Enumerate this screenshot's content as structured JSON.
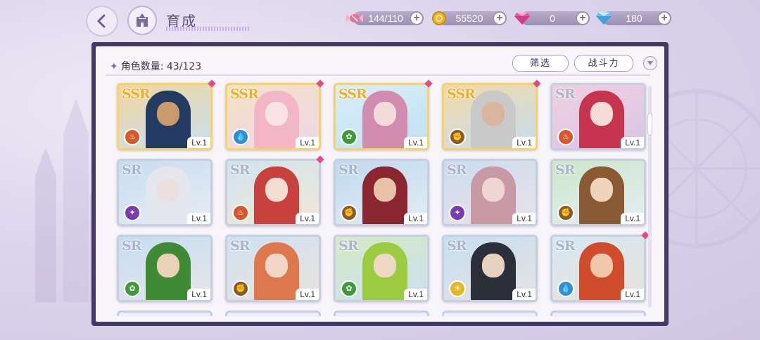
{
  "header": {
    "title": "育成",
    "back_icon": "back-arrow-icon",
    "home_icon": "castle-home-icon"
  },
  "currencies": [
    {
      "icon": "candy-stamina-icon",
      "value": "144/110"
    },
    {
      "icon": "gold-coin-icon",
      "value": "55520"
    },
    {
      "icon": "pink-gem-icon",
      "value": "0"
    },
    {
      "icon": "blue-diamond-icon",
      "value": "180"
    }
  ],
  "panel": {
    "count_label": "角色数量: 43/123",
    "filter_label": "筛选",
    "sort_label": "战斗力"
  },
  "cards": [
    {
      "rarity": "SSR",
      "level": "Lv.1",
      "attr": "fire",
      "new": true,
      "hair": "#233a63",
      "tone": "#c99a6a",
      "bg": [
        "#f3d6a0",
        "#c9e0f0"
      ]
    },
    {
      "rarity": "SSR",
      "level": "Lv.1",
      "attr": "water",
      "new": true,
      "hair": "#f2b6c8",
      "tone": "#f7e3e6",
      "bg": [
        "#f4e2c4",
        "#eed6e8"
      ]
    },
    {
      "rarity": "SSR",
      "level": "Lv.1",
      "attr": "grass",
      "new": true,
      "hair": "#d28cb0",
      "tone": "#f2dbd9",
      "bg": [
        "#d9eef8",
        "#bfe1f2"
      ]
    },
    {
      "rarity": "SSR",
      "level": "Lv.1",
      "attr": "earth",
      "new": true,
      "hair": "#c9c9c9",
      "tone": "#d8b59c",
      "bg": [
        "#f2d9a8",
        "#c7dff0"
      ]
    },
    {
      "rarity": "SR",
      "level": "Lv.1",
      "attr": "fire",
      "new": false,
      "hair": "#c7344f",
      "tone": "#f5dcd6",
      "bg": [
        "#f1cfe0",
        "#d8c6e6"
      ]
    },
    {
      "rarity": "SR",
      "level": "Lv.1",
      "attr": "dark",
      "new": false,
      "hair": "#e6e6ee",
      "tone": "#ecdfe0",
      "bg": [
        "#c7dcef",
        "#e7edf5"
      ]
    },
    {
      "rarity": "SR",
      "level": "Lv.1",
      "attr": "fire",
      "new": true,
      "hair": "#c9413d",
      "tone": "#f6ddd2",
      "bg": [
        "#cfe4f2",
        "#f3e8d2"
      ]
    },
    {
      "rarity": "SR",
      "level": "Lv.1",
      "attr": "earth",
      "new": false,
      "hair": "#8a2630",
      "tone": "#e6c2a8",
      "bg": [
        "#bfd9ee",
        "#e3edf4"
      ]
    },
    {
      "rarity": "SR",
      "level": "Lv.1",
      "attr": "dark",
      "new": false,
      "hair": "#c89aa6",
      "tone": "#f0d6d2",
      "bg": [
        "#cbdcee",
        "#eae2ea"
      ]
    },
    {
      "rarity": "SR",
      "level": "Lv.1",
      "attr": "earth",
      "new": false,
      "hair": "#8a5a34",
      "tone": "#f1d4bc",
      "bg": [
        "#cde6c8",
        "#e4eef6"
      ]
    },
    {
      "rarity": "SR",
      "level": "Lv.1",
      "attr": "grass",
      "new": false,
      "hair": "#3f8a34",
      "tone": "#ecd1b9",
      "bg": [
        "#c6ddf0",
        "#e6e6ea"
      ]
    },
    {
      "rarity": "SR",
      "level": "Lv.1",
      "attr": "earth",
      "new": false,
      "hair": "#e0784e",
      "tone": "#f2d6c6",
      "bg": [
        "#cfe2f2",
        "#e9e2dc"
      ]
    },
    {
      "rarity": "SR",
      "level": "Lv.1",
      "attr": "grass",
      "new": false,
      "hair": "#9ccb3f",
      "tone": "#efd9c4",
      "bg": [
        "#d7e9c6",
        "#c9e0ef"
      ]
    },
    {
      "rarity": "SR",
      "level": "Lv.1",
      "attr": "light",
      "new": false,
      "hair": "#2b2f3a",
      "tone": "#e7d2c2",
      "bg": [
        "#c7def0",
        "#e6e2e4"
      ]
    },
    {
      "rarity": "SR",
      "level": "Lv.1",
      "attr": "water",
      "new": true,
      "hair": "#cf4b2a",
      "tone": "#efc9aa",
      "bg": [
        "#d5e8f4",
        "#eae2d8"
      ]
    }
  ],
  "attr_colors": {
    "fire": "#d8582e",
    "water": "#2f8fd6",
    "grass": "#3f9a3c",
    "earth": "#8a5a2c",
    "dark": "#7a3cb2",
    "light": "#e3b824"
  }
}
